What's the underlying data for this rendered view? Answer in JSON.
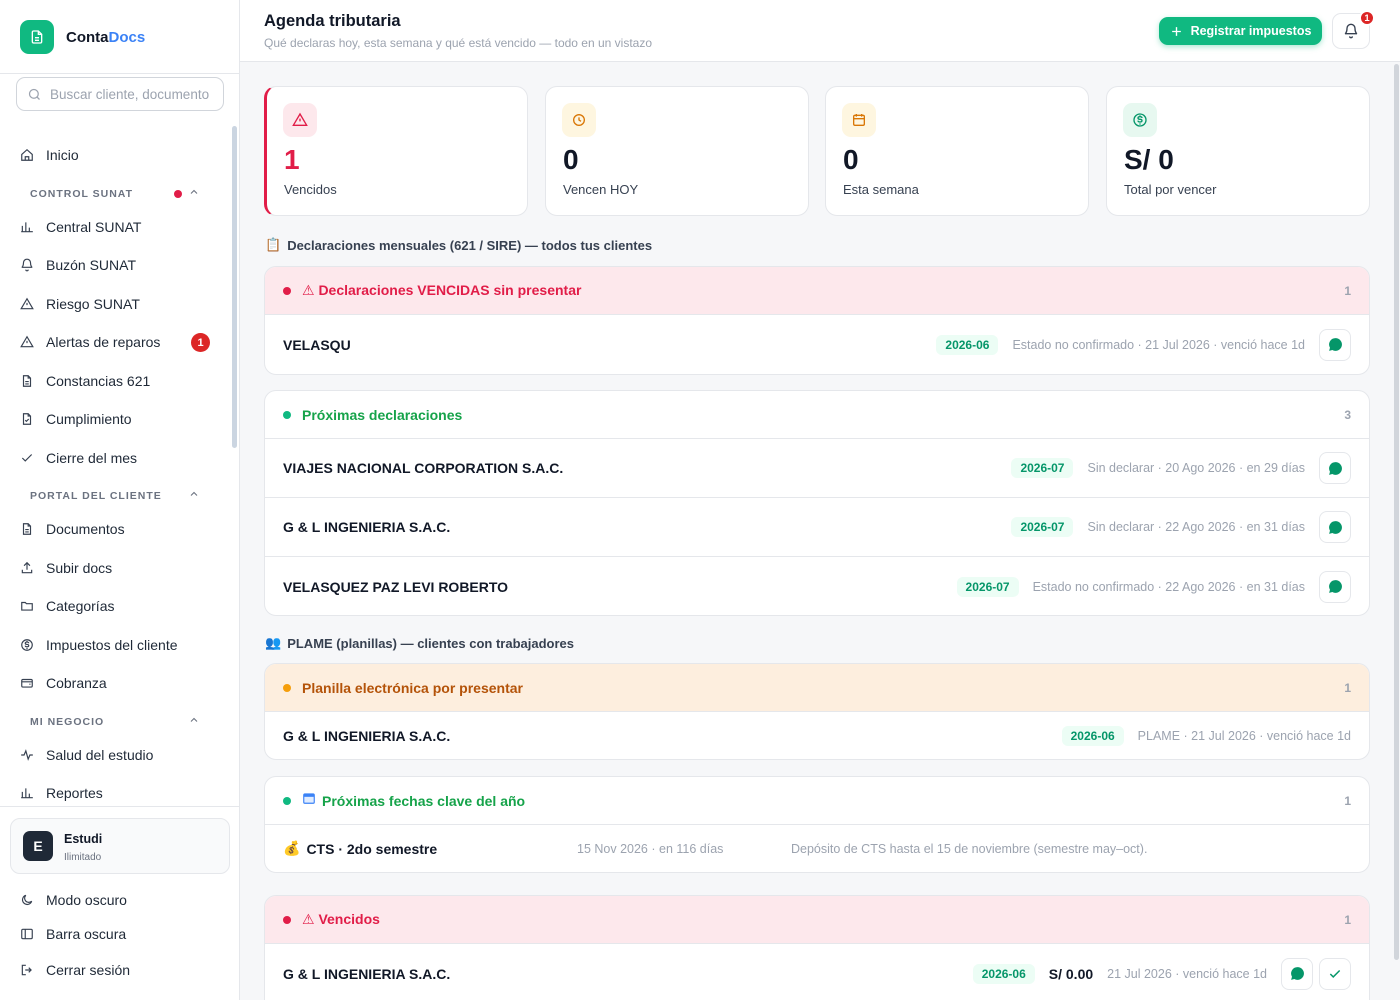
{
  "brand": {
    "name_main": "Conta",
    "name_accent": "Docs"
  },
  "search": {
    "placeholder": "Buscar cliente, documento..."
  },
  "sidebar": {
    "home": "Inicio",
    "sections": {
      "control": "CONTROL SUNAT",
      "portal": "PORTAL DEL CLIENTE",
      "negocio": "MI NEGOCIO"
    },
    "control_items": [
      "Central SUNAT",
      "Buzón SUNAT",
      "Riesgo SUNAT",
      "Alertas de reparos",
      "Constancias 621",
      "Cumplimiento",
      "Cierre del mes"
    ],
    "alertas_badge": "1",
    "portal_items": [
      "Documentos",
      "Subir docs",
      "Categorías",
      "Impuestos del cliente",
      "Cobranza"
    ],
    "negocio_items": [
      "Salud del estudio",
      "Reportes"
    ],
    "account": {
      "initial": "E",
      "name": "Estudi",
      "plan": "Ilimitado"
    },
    "footer_items": [
      "Modo oscuro",
      "Barra oscura",
      "Cerrar sesión"
    ]
  },
  "header": {
    "title": "Agenda tributaria",
    "subtitle": "Qué declaras hoy, esta semana y qué está vencido — todo en un vistazo",
    "primary_button": "Registrar impuestos",
    "bell_badge": "1"
  },
  "stats": [
    {
      "value": "1",
      "label": "Vencidos",
      "icon": "alert-triangle-icon",
      "color": "#e11d48",
      "bg": "#fde8ec"
    },
    {
      "value": "0",
      "label": "Vencen HOY",
      "icon": "clock-icon",
      "color": "#d97706",
      "bg": "#fef6e0"
    },
    {
      "value": "0",
      "label": "Esta semana",
      "icon": "calendar-icon",
      "color": "#d97706",
      "bg": "#fef6e0"
    },
    {
      "value": "S/ 0",
      "label": "Total por vencer",
      "icon": "dollar-circle-icon",
      "color": "#059669",
      "bg": "#e7f8f0"
    }
  ],
  "sections": {
    "mensuales": "Declaraciones mensuales (621 / SIRE) — todos tus clientes",
    "plame": "PLAME (planillas) — clientes con trabajadores"
  },
  "groups": {
    "vencidas": {
      "title": "⚠ Declaraciones VENCIDAS sin presentar",
      "count": "1",
      "rows": [
        {
          "name": "VELASQU",
          "period": "2026-06",
          "meta": "Estado no confirmado · 21 Jul 2026 · venció hace 1d"
        }
      ]
    },
    "proximas": {
      "title": "Próximas declaraciones",
      "count": "3",
      "rows": [
        {
          "name": "VIAJES NACIONAL CORPORATION S.A.C.",
          "period": "2026-07",
          "meta": "Sin declarar · 20 Ago 2026 · en 29 días"
        },
        {
          "name": "G & L INGENIERIA S.A.C.",
          "period": "2026-07",
          "meta": "Sin declarar · 22 Ago 2026 · en 31 días"
        },
        {
          "name": "VELASQUEZ PAZ LEVI ROBERTO",
          "period": "2026-07",
          "meta": "Estado no confirmado · 22 Ago 2026 · en 31 días"
        }
      ]
    },
    "plame": {
      "title": "Planilla electrónica por presentar",
      "count": "1",
      "rows": [
        {
          "name": "G & L INGENIERIA S.A.C.",
          "period": "2026-06",
          "meta": "PLAME · 21 Jul 2026 · venció hace 1d"
        }
      ]
    },
    "fechas": {
      "title": "Próximas fechas clave del año",
      "count": "1",
      "rows": [
        {
          "name": "CTS · 2do semestre",
          "date": "15 Nov 2026 · en 116 días",
          "desc": "Depósito de CTS hasta el 15 de noviembre (semestre may–oct)."
        }
      ]
    },
    "vencidos": {
      "title": "⚠ Vencidos",
      "count": "1",
      "rows": [
        {
          "name": "G & L INGENIERIA S.A.C.",
          "period": "2026-06",
          "amount": "S/ 0.00",
          "meta": "21 Jul 2026 · venció hace 1d"
        }
      ]
    }
  },
  "colors": {
    "accent": "#10b981",
    "danger": "#e11d48",
    "warning": "#d97706"
  }
}
